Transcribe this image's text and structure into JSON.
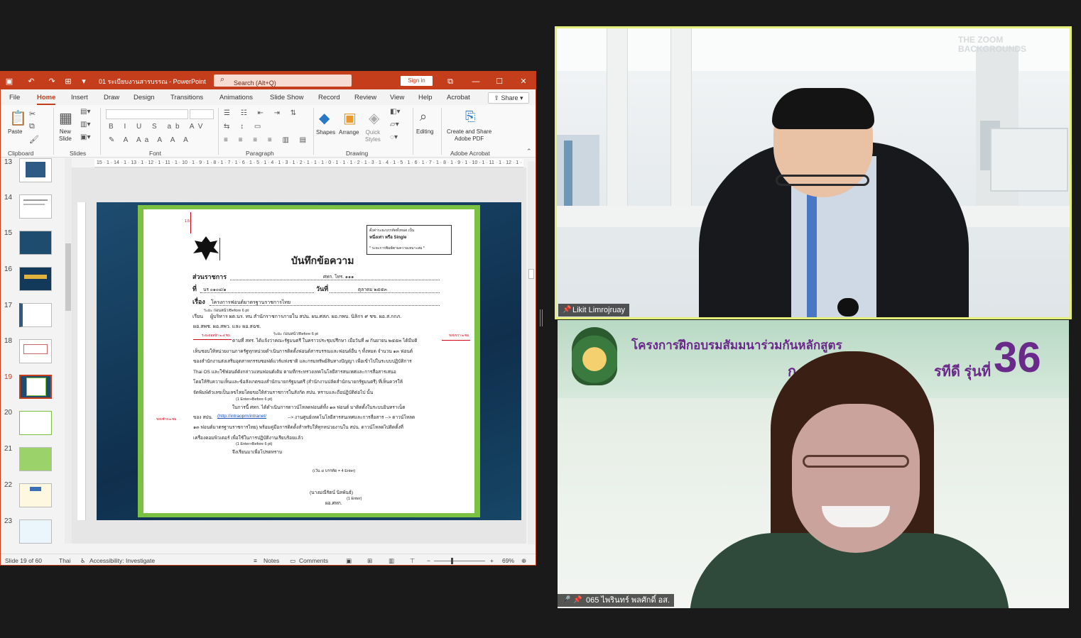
{
  "ppt": {
    "title": "01 ระเบียบงานสารบรรณ - PowerPoint",
    "search_placeholder": "Search (Alt+Q)",
    "sign_in": "Sign in",
    "tabs": [
      "File",
      "Home",
      "Insert",
      "Draw",
      "Design",
      "Transitions",
      "Animations",
      "Slide Show",
      "Record",
      "Review",
      "View",
      "Help",
      "Acrobat"
    ],
    "active_tab": "Home",
    "share_label": "Share",
    "ribbon": {
      "paste": "Paste",
      "new_slide": "New\nSlide",
      "groups": [
        "Clipboard",
        "Slides",
        "Font",
        "Paragraph",
        "Drawing",
        "Adobe Acrobat"
      ],
      "shapes": "Shapes",
      "arrange": "Arrange",
      "quick_styles": "Quick\nStyles",
      "editing": "Editing",
      "create_share_pdf": "Create and Share\nAdobe PDF"
    },
    "thumbnails": [
      "13",
      "14",
      "15",
      "16",
      "17",
      "18",
      "19",
      "20",
      "21",
      "22",
      "23"
    ],
    "active_thumbnail": "19",
    "ruler_text": "15 · 1 · 14 · 1 · 13 · 1 · 12 · 1 · 11 · 1 · 10 · 1 · 9 · 1 · 8 · 1 · 7 · 1 · 6 · 1 · 5 · 1 · 4 · 1 · 3 · 1 · 2 · 1 · 1 · 1 · 0 · 1 · 1 · 1 · 2 · 1 · 3 · 1 · 4 · 1 · 5 · 1 · 6 · 1 · 7 · 1 · 8 · 1 · 9 · 1 · 10 · 1 · 11 · 1 · 12 · 1 · 13 · 1 · 14 · 1 · 15",
    "status": {
      "slide_of": "Slide 19 of 60",
      "language": "Thai",
      "accessibility": "Accessibility: Investigate",
      "notes": "Notes",
      "comments": "Comments",
      "zoom": "69%"
    }
  },
  "memo": {
    "heading": "บันทึกข้อความ",
    "box_line1": "ตั้งค่าระยะบรรทัดทั้งหมด เป็น",
    "box_line2": "หนึ่งเท่า หรือ Single",
    "box_line3": "* ระยะการพิมพ์ตามความเหมาะสม *",
    "dept_label": "ส่วนราชการ",
    "dept_value": "ศทก.   โทร. ๑๑๑",
    "no_label": "ที่",
    "no_value": "นร ๐๑๐๔/๑",
    "date_label": "วันที่",
    "date_value": "ตุลาคม ๒๕๕๓",
    "subject_label": "เรื่อง",
    "subject_value": "โครงการฟอนต์มาตรฐานราชการไทย",
    "before6": "ระยะ ก่อนหน้า/Before 6 pt",
    "to_label": "เรียน",
    "to_line1": "ผู้บริหาร ผต.นร. ทน สำนักราชการภายใน สปน. ผน.ศสภ. ผอ.กพบ. นิลิกร ๙ ชข. ผอ.ส.กกภ.",
    "to_line2": "ผอ.สพช. ผอ.สพว. และ ผอ.สฉช.",
    "body_line1": "ตามที่ สทร. ได้แจ้งว่าคณะรัฐมนตรี ในคราวประชุมปรึกษา เมื่อวันที่ ๗ กันยายน ๒๕๕๓ ได้มีมติ",
    "body_line2": "เห็นชอบให้หน่วยงานภาครัฐทุกหน่วยดำเนินการติดตั้งฟอนต์สารบรรณและฟอนต์อื่น ๆ ทั้งหมด จำนวน ๑๓ ฟอนต์",
    "body_line3": "ของสำนักงานส่งเสริมอุตสาหกรรมซอฟต์แวร์แห่งชาติ และกรมทรัพย์สินทางปัญญา เพื่อเข้าไปในระบบปฏิบัติการ",
    "body_line4": "Thai    OS และใช้ฟอนต์ดังกล่าวแทนฟอนต์เดิม ตามที่กระทรวงเทคโนโลยีสารสนเทศและการสื่อสารเสนอ",
    "body_line5": "โดยให้รับความเห็นและข้อสังเกตของสำนักนายกรัฐมนตรี (สำนักงานปลัดสำนักนายกรัฐมนตรี) ที่เห็นควรให้",
    "body_line6": "จัดพิมพ์ตัวเลขเป็นเลขไทยโดยขอให้ส่วนราชการในสังกัด สปน. ทราบและถือปฏิบัติต่อไป  นั้น",
    "enter1": "(1 Enter+Before 6 pt)",
    "body2_line1": "ในการนี้ ศทก. ได้ดำเนินการดาวน์โหลดฟอนต์ทั้ง ๑๓ ฟอนต์ มาติดตั้งในระบบอินทราเน็ต",
    "body2_line2_pre": "ของ สปน.",
    "body2_link": "(http://intraopm/intranet/",
    "body2_line2_post": "--> งานศูนย์เทคโนโลยีสารสนเทศและการสื่อสาร --> ดาวน์โหลด",
    "body2_line3": "๑๓ ฟอนต์มาตรฐานราชการไทย) พร้อมคู่มือการติดตั้งสำหรับให้ทุกหน่วยงานใน สปน. ดาวน์โหลดไปติดตั้งที่",
    "body2_line4": "เครื่องคอมพิวเตอร์ เพื่อใช้ในการปฏิบัติงานเรียบร้อยแล้ว",
    "enter2": "(1 Enter+Before 6 pt)",
    "closing": "จึงเรียนมาเพื่อโปรดทราบ",
    "four_enter": "(เว้น ๔ บรรทัด = 4 Enter)",
    "signer": "(นางมณีรัตน์  นิลพันธ์)",
    "signer_title": "ผอ.ศทก.",
    "enter3": "(1 Enter)",
    "margin_left": "ขอบซ้าย ๓ ซม.",
    "margin_right": "ขอบขวา ๒ ซม.",
    "indent": "ระยะย่อหน้า ๒.๕ ซม."
  },
  "video": {
    "tile1_name": "Likit Limrojruay",
    "tile1_watermark": "THE ZOOM BACKGROUNDS",
    "tile2_name": "065 ไพรินทร์ พลศักดิ์ อส.",
    "banner_line1": "โครงการฝึกอบรมสัมมนาร่วมกันหลักสูตร",
    "banner_line2": "ก",
    "banner_line2b": "รทีดี รุ่นที่",
    "banner_number": "36"
  },
  "colors": {
    "ppt_accent": "#c43e1c",
    "active_speaker": "#e4ef7a",
    "page_frame": "#7cc242"
  }
}
